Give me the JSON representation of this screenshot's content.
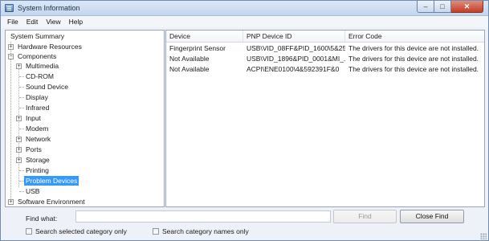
{
  "window": {
    "title": "System Information",
    "controls": {
      "minimize": "‒",
      "maximize": "□",
      "close": "✕"
    }
  },
  "menu": [
    "File",
    "Edit",
    "View",
    "Help"
  ],
  "tree": {
    "root": "System Summary",
    "items": [
      {
        "label": "Hardware Resources",
        "expander": "+",
        "level": 1
      },
      {
        "label": "Components",
        "expander": "−",
        "level": 1
      },
      {
        "label": "Multimedia",
        "expander": "+",
        "level": 2
      },
      {
        "label": "CD-ROM",
        "expander": "",
        "level": 2
      },
      {
        "label": "Sound Device",
        "expander": "",
        "level": 2
      },
      {
        "label": "Display",
        "expander": "",
        "level": 2
      },
      {
        "label": "Infrared",
        "expander": "",
        "level": 2
      },
      {
        "label": "Input",
        "expander": "+",
        "level": 2
      },
      {
        "label": "Modem",
        "expander": "",
        "level": 2
      },
      {
        "label": "Network",
        "expander": "+",
        "level": 2
      },
      {
        "label": "Ports",
        "expander": "+",
        "level": 2
      },
      {
        "label": "Storage",
        "expander": "+",
        "level": 2
      },
      {
        "label": "Printing",
        "expander": "",
        "level": 2
      },
      {
        "label": "Problem Devices",
        "expander": "",
        "level": 2,
        "selected": true
      },
      {
        "label": "USB",
        "expander": "",
        "level": 2
      },
      {
        "label": "Software Environment",
        "expander": "+",
        "level": 1
      }
    ]
  },
  "table": {
    "columns": [
      "Device",
      "PNP Device ID",
      "Error Code"
    ],
    "rows": [
      [
        "Fingerprint Sensor",
        "USB\\VID_08FF&PID_1600\\5&25...",
        "The drivers for this device are not installed."
      ],
      [
        "Not Available",
        "USB\\VID_1896&PID_0001&MI_...",
        "The drivers for this device are not installed."
      ],
      [
        "Not Available",
        "ACPI\\ENE0100\\4&592391F&0",
        "The drivers for this device are not installed."
      ]
    ]
  },
  "find": {
    "label": "Find what:",
    "value": "",
    "find_button": "Find",
    "close_find_button": "Close Find",
    "search_selected_label": "Search selected category only",
    "search_names_label": "Search category names only"
  },
  "colors": {
    "selection": "#3399ff",
    "title_bar": "#c3d6ee"
  }
}
